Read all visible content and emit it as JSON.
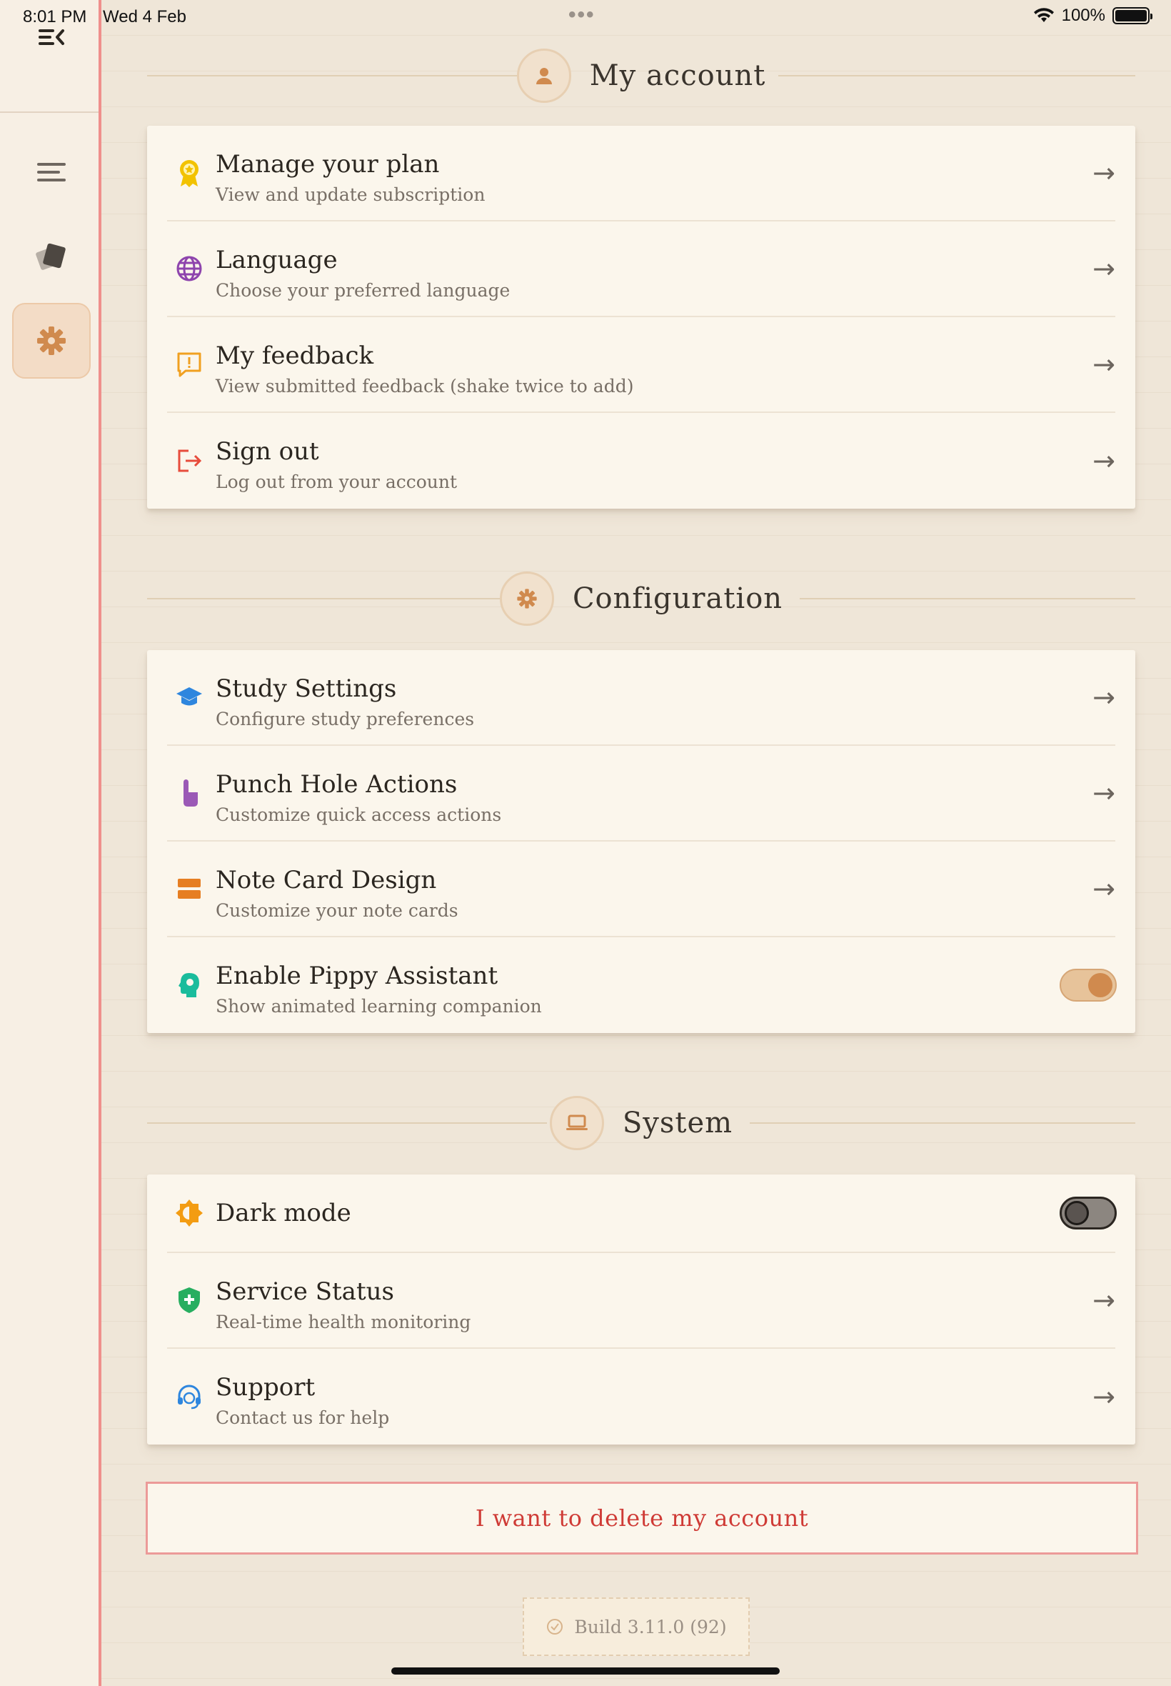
{
  "status_bar": {
    "time": "8:01 PM",
    "date": "Wed 4 Feb",
    "dots": "•••",
    "battery": "100%"
  },
  "sidebar": {
    "items": [
      {
        "name": "collapse-sidebar",
        "icon": "collapse-menu-icon"
      },
      {
        "name": "list",
        "icon": "list-icon"
      },
      {
        "name": "cards",
        "icon": "cards-icon"
      },
      {
        "name": "settings",
        "icon": "gear-icon",
        "active": true
      }
    ]
  },
  "sections": {
    "account": {
      "title": "My account",
      "rows": [
        {
          "title": "Manage your plan",
          "subtitle": "View and update subscription"
        },
        {
          "title": "Language",
          "subtitle": "Choose your preferred language"
        },
        {
          "title": "My feedback",
          "subtitle": "View submitted feedback (shake twice to add)"
        },
        {
          "title": "Sign out",
          "subtitle": "Log out from your account"
        }
      ]
    },
    "configuration": {
      "title": "Configuration",
      "rows": [
        {
          "title": "Study Settings",
          "subtitle": "Configure study preferences"
        },
        {
          "title": "Punch Hole Actions",
          "subtitle": "Customize quick access actions"
        },
        {
          "title": "Note Card Design",
          "subtitle": "Customize your note cards"
        },
        {
          "title": "Enable Pippy Assistant",
          "subtitle": "Show animated learning companion",
          "toggle": true
        }
      ]
    },
    "system": {
      "title": "System",
      "rows": [
        {
          "title": "Dark mode",
          "toggle": false
        },
        {
          "title": "Service Status",
          "subtitle": "Real-time health monitoring"
        },
        {
          "title": "Support",
          "subtitle": "Contact us for help"
        }
      ]
    }
  },
  "arrow": "→",
  "delete_label": "I want to delete my account",
  "build_label": "Build 3.11.0 (92)",
  "colors": {
    "accent": "#d08a4e",
    "danger": "#cf3b36",
    "margin_line": "#ef8f8c"
  }
}
